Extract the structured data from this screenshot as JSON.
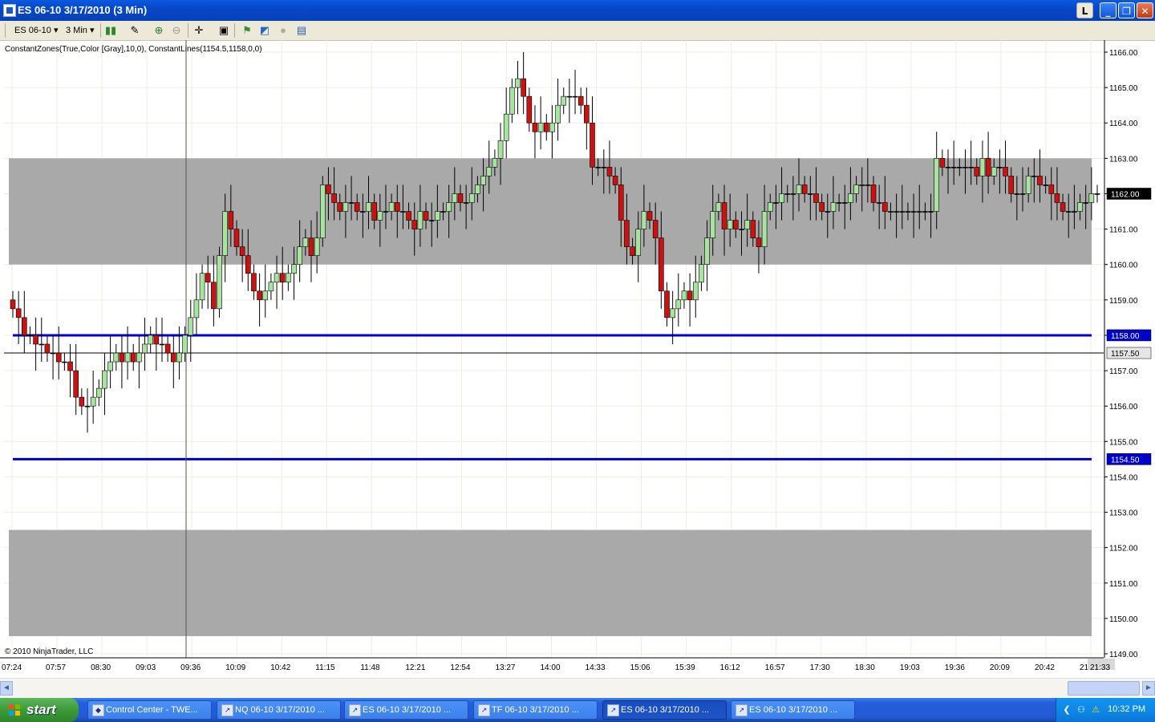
{
  "window": {
    "title": "ES 06-10  3/17/2010 (3 Min)",
    "btn_l": "L",
    "btn_min": "_",
    "btn_max": "❐",
    "btn_close": "✕"
  },
  "toolbar": {
    "instrument": "ES 06-10",
    "interval": "3 Min"
  },
  "chart": {
    "indicator_label": "ConstantZones(True,Color [Gray],10,0), ConstantLines(1154.5,1158,0,0)",
    "copyright": "© 2010 NinjaTrader, LLC",
    "zone_color": "#a9a9a9",
    "line_color": "#0000cc",
    "up_color": "#a8e4a0",
    "down_color": "#cc1111"
  },
  "chart_data": {
    "type": "candlestick",
    "y_ticks": [
      "1166.00",
      "1165.00",
      "1164.00",
      "1163.00",
      "1162.00",
      "1161.00",
      "1160.00",
      "1159.00",
      "1158.00",
      "1157.00",
      "1156.00",
      "1155.00",
      "1154.00",
      "1153.00",
      "1152.00",
      "1151.00",
      "1150.00",
      "1149.00"
    ],
    "ylim": [
      1149,
      1166.3
    ],
    "x_ticks": [
      "07:24",
      "07:57",
      "08:30",
      "09:03",
      "09:36",
      "10:09",
      "10:42",
      "11:15",
      "11:48",
      "12:21",
      "12:54",
      "13:27",
      "14:00",
      "14:33",
      "15:06",
      "15:39",
      "16:12",
      "16:57",
      "17:30",
      "18:30",
      "19:03",
      "19:36",
      "20:09",
      "20:42",
      "21:15",
      "21:33"
    ],
    "zones": [
      [
        1160,
        1163
      ],
      [
        1149.5,
        1152.5
      ]
    ],
    "constant_lines": [
      1158.0,
      1154.5
    ],
    "current_price": 1162.0,
    "crosshair_price": 1157.5,
    "closes": [
      1158.75,
      1158.5,
      1158.0,
      1158.0,
      1157.75,
      1157.75,
      1157.5,
      1157.5,
      1157.25,
      1157.25,
      1157.0,
      1156.25,
      1156.0,
      1156.0,
      1156.25,
      1156.5,
      1157.0,
      1157.25,
      1157.5,
      1157.25,
      1157.5,
      1157.25,
      1157.5,
      1157.75,
      1158.0,
      1157.75,
      1157.75,
      1157.5,
      1157.25,
      1157.5,
      1158.0,
      1158.5,
      1159.0,
      1159.75,
      1159.5,
      1158.75,
      1160.25,
      1161.5,
      1161.0,
      1160.5,
      1160.25,
      1159.75,
      1159.25,
      1159.0,
      1159.25,
      1159.5,
      1159.75,
      1159.5,
      1159.75,
      1160.0,
      1160.5,
      1160.75,
      1160.25,
      1160.75,
      1162.25,
      1162.0,
      1161.75,
      1161.5,
      1161.75,
      1161.75,
      1161.5,
      1161.5,
      1161.75,
      1161.25,
      1161.5,
      1161.5,
      1161.75,
      1161.5,
      1161.5,
      1161.25,
      1161.0,
      1161.5,
      1161.25,
      1161.25,
      1161.5,
      1161.5,
      1161.75,
      1162.0,
      1161.75,
      1161.75,
      1162.0,
      1162.25,
      1162.5,
      1162.75,
      1163.0,
      1163.5,
      1164.25,
      1165.0,
      1165.25,
      1164.75,
      1164.0,
      1163.75,
      1164.0,
      1163.75,
      1164.0,
      1164.5,
      1164.75,
      1164.75,
      1164.75,
      1164.5,
      1164.0,
      1162.75,
      1162.75,
      1162.75,
      1162.5,
      1162.25,
      1161.25,
      1160.5,
      1160.25,
      1161.0,
      1161.5,
      1161.25,
      1160.75,
      1159.25,
      1158.5,
      1158.75,
      1159.0,
      1159.25,
      1159.0,
      1159.5,
      1160.0,
      1160.75,
      1161.5,
      1161.75,
      1161.0,
      1161.25,
      1161.0,
      1161.0,
      1161.25,
      1160.75,
      1160.5,
      1161.5,
      1161.75,
      1161.75,
      1162.0,
      1162.0,
      1162.0,
      1162.25,
      1162.0,
      1162.0,
      1161.75,
      1161.5,
      1161.5,
      1161.75,
      1161.75,
      1161.75,
      1162.0,
      1162.25,
      1162.25,
      1162.25,
      1161.75,
      1161.75,
      1161.5,
      1161.5,
      1161.5,
      1161.5,
      1161.5,
      1161.5,
      1161.5,
      1161.5,
      1161.5,
      1163.0,
      1162.75,
      1162.75,
      1162.75,
      1162.75,
      1162.75,
      1162.75,
      1162.5,
      1163.0,
      1162.5,
      1162.75,
      1162.75,
      1162.5,
      1162.0,
      1162.0,
      1162.0,
      1162.5,
      1162.5,
      1162.25,
      1162.25,
      1162.0,
      1161.75,
      1161.5,
      1161.5,
      1161.5,
      1161.75,
      1161.75,
      1162.0,
      1162.0
    ]
  },
  "scrollbar": {
    "left": "◄",
    "right": "►"
  },
  "taskbar": {
    "start": "start",
    "tasks": [
      "Control Center - TWE...",
      "NQ 06-10  3/17/2010 ...",
      "ES 06-10  3/17/2010 ...",
      "TF 06-10  3/17/2010 ...",
      "ES 06-10  3/17/2010 ...",
      "ES 06-10  3/17/2010 ..."
    ],
    "clock": "10:32 PM"
  }
}
